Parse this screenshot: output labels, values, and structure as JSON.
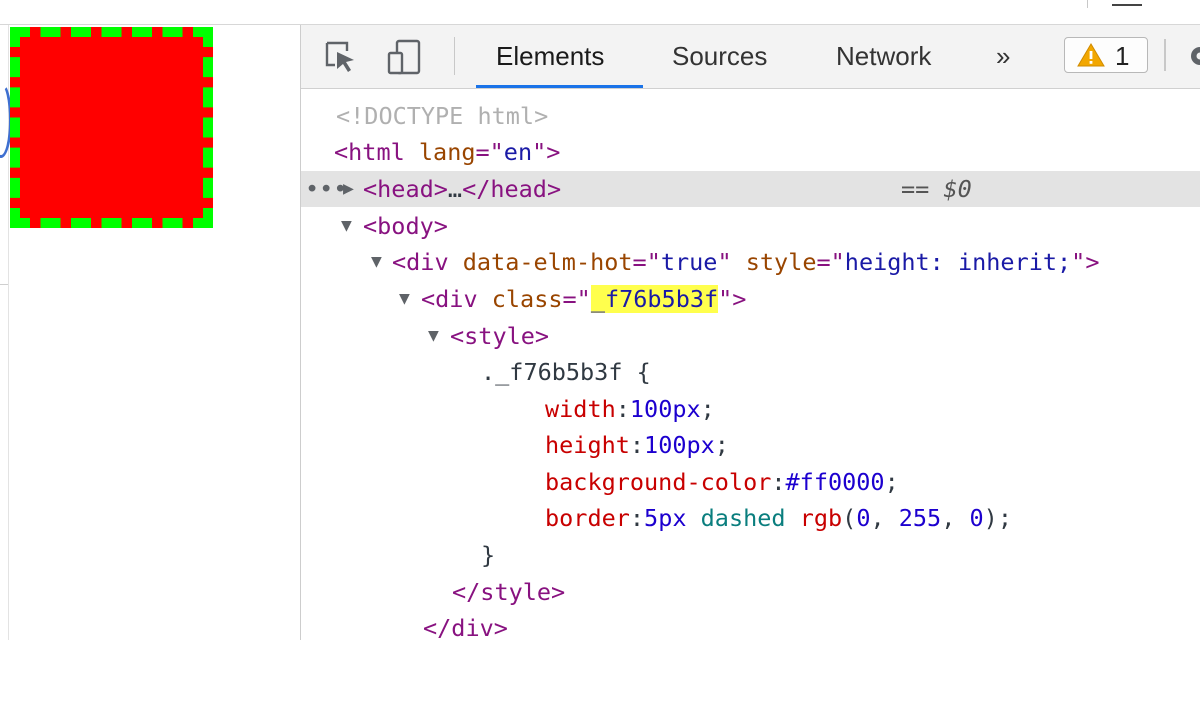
{
  "devtools": {
    "tabs": [
      {
        "label": "Elements",
        "active": true
      },
      {
        "label": "Sources",
        "active": false
      },
      {
        "label": "Network",
        "active": false
      }
    ],
    "more_tabs": "»",
    "warning_count": "1"
  },
  "page": {
    "box_background": "#ff0000",
    "box_border_color": "#00ff00"
  },
  "tree": {
    "doctype": "<!DOCTYPE html>",
    "html_lang_attr": "lang",
    "html_lang_val": "en",
    "selected_suffix": "== $0",
    "ellipsis": "…",
    "div1_attr1": "data-elm-hot",
    "div1_val1": "true",
    "div1_attr2": "style",
    "div1_val2": "height: inherit;",
    "div2_attr": "class",
    "div2_val": "_f76b5b3f",
    "css_selector": "._f76b5b3f {",
    "css_width_prop": "width",
    "css_width_val": "100px",
    "css_height_prop": "height",
    "css_height_val": "100px",
    "css_bg_prop": "background-color",
    "css_bg_val": "#ff0000",
    "css_border_prop": "border",
    "css_border_width": "5px",
    "css_border_style": "dashed",
    "css_border_fn": "rgb",
    "css_border_r": "0",
    "css_border_g": "255",
    "css_border_b": "0",
    "css_close": "}"
  }
}
